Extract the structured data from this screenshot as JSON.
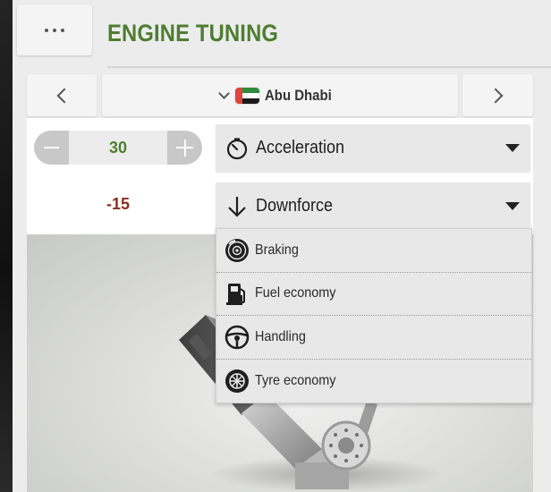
{
  "header": {
    "title": "ENGINE TUNING",
    "menu_icon": "more-dots-icon"
  },
  "location_nav": {
    "current": "Abu Dhabi",
    "flag_colors": {
      "red": "#e0443b",
      "green": "#2e8b3a",
      "white": "#ffffff",
      "black": "#1a1a1a"
    }
  },
  "tuning": {
    "stepper_value": "30",
    "secondary_value": "-15",
    "primary_select": {
      "label": "Acceleration",
      "icon": "stopwatch-icon"
    },
    "secondary_select": {
      "label": "Downforce",
      "icon": "arrow-down-icon"
    }
  },
  "dropdown": {
    "options": [
      {
        "label": "Braking",
        "icon": "brake-disc-icon"
      },
      {
        "label": "Fuel economy",
        "icon": "fuel-pump-icon"
      },
      {
        "label": "Handling",
        "icon": "steering-wheel-icon"
      },
      {
        "label": "Tyre economy",
        "icon": "tyre-icon"
      }
    ]
  },
  "colors": {
    "title_green": "#4e7d30",
    "positive_value": "#4e7d30",
    "negative_value": "#8e2c22",
    "panel_bg": "#ececec"
  }
}
